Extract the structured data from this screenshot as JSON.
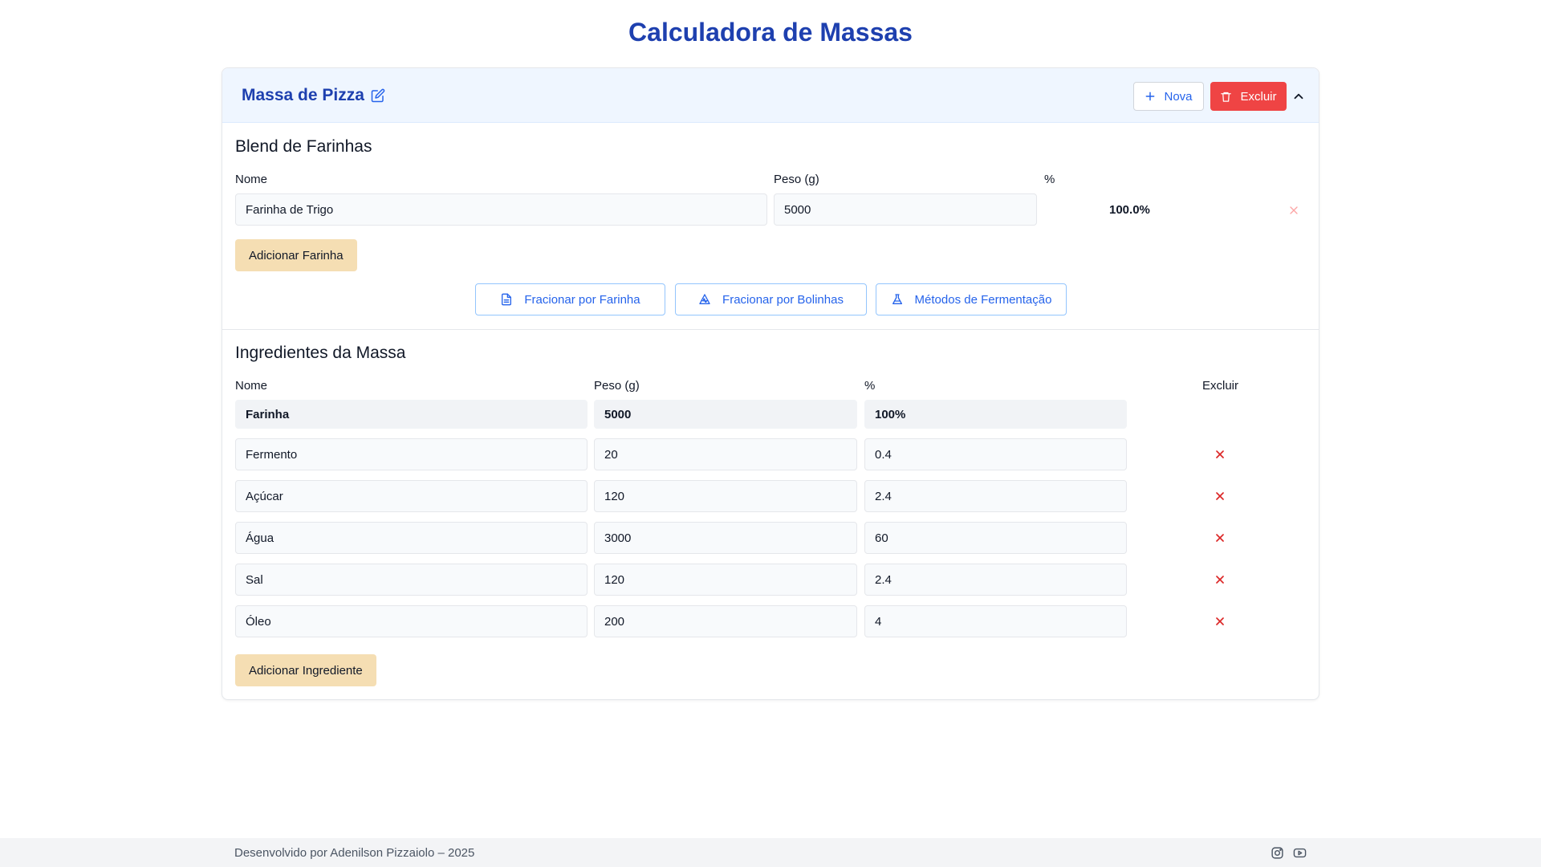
{
  "app": {
    "title": "Calculadora de Massas"
  },
  "recipe": {
    "name": "Massa de Pizza",
    "buttons": {
      "new": "Nova",
      "delete": "Excluir"
    }
  },
  "flour_blend": {
    "title": "Blend de Farinhas",
    "columns": {
      "name": "Nome",
      "weight": "Peso (g)",
      "percent": "%"
    },
    "items": [
      {
        "name": "Farinha de Trigo",
        "weight": "5000",
        "percent": "100.0%"
      }
    ],
    "add_button": "Adicionar Farinha"
  },
  "actions": {
    "by_flour": "Fracionar por Farinha",
    "by_balls": "Fracionar por Bolinhas",
    "fermentation": "Métodos de Fermentação"
  },
  "ingredients": {
    "title": "Ingredientes da Massa",
    "columns": {
      "name": "Nome",
      "weight": "Peso (g)",
      "percent": "%",
      "delete": "Excluir"
    },
    "base": {
      "name": "Farinha",
      "weight": "5000",
      "percent": "100%"
    },
    "items": [
      {
        "name": "Fermento",
        "weight": "20",
        "percent": "0.4"
      },
      {
        "name": "Açúcar",
        "weight": "120",
        "percent": "2.4"
      },
      {
        "name": "Água",
        "weight": "3000",
        "percent": "60"
      },
      {
        "name": "Sal",
        "weight": "120",
        "percent": "2.4"
      },
      {
        "name": "Óleo",
        "weight": "200",
        "percent": "4"
      }
    ],
    "add_button": "Adicionar Ingrediente"
  },
  "footer": {
    "text": "Desenvolvido por Adenilson Pizzaiolo – 2025",
    "icons": [
      "instagram-icon",
      "youtube-icon"
    ]
  },
  "colors": {
    "accent": "#1e40af",
    "link": "#2563eb",
    "danger": "#ef4444",
    "add_button": "#f5deb3"
  }
}
